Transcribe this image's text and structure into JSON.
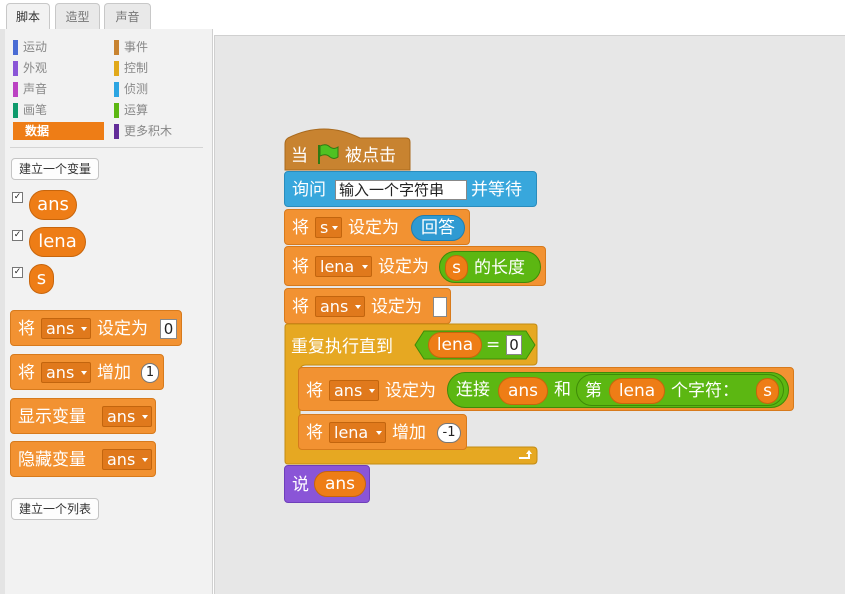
{
  "tabs": [
    "脚本",
    "造型",
    "声音"
  ],
  "categories": [
    {
      "label": "运动",
      "color": "#4a6cd4"
    },
    {
      "label": "外观",
      "color": "#8a55d7"
    },
    {
      "label": "声音",
      "color": "#bb42c3"
    },
    {
      "label": "画笔",
      "color": "#0e9a6c"
    },
    {
      "label": "数据",
      "color": "#ee7d16"
    },
    {
      "label": "事件",
      "color": "#c88330"
    },
    {
      "label": "控制",
      "color": "#e1a91a"
    },
    {
      "label": "侦测",
      "color": "#2ca5e2"
    },
    {
      "label": "运算",
      "color": "#5cb712"
    },
    {
      "label": "更多积木",
      "color": "#632d99"
    }
  ],
  "selected_category": "数据",
  "palette": {
    "make_variable": "建立一个变量",
    "make_list": "建立一个列表",
    "variables": [
      {
        "name": "ans",
        "checked": true
      },
      {
        "name": "lena",
        "checked": true
      },
      {
        "name": "s",
        "checked": true
      }
    ],
    "set_block": {
      "prefix": "将",
      "var": "ans",
      "suffix": "设定为",
      "value": "0"
    },
    "change_block": {
      "prefix": "将",
      "var": "ans",
      "suffix": "增加",
      "value": "1"
    },
    "show_block": {
      "prefix": "显示变量",
      "var": "ans"
    },
    "hide_block": {
      "prefix": "隐藏变量",
      "var": "ans"
    }
  },
  "script": {
    "hat": {
      "pre": "当",
      "post": "被点击"
    },
    "ask": {
      "pre": "询问",
      "prompt": "输入一个字符串",
      "post": "并等待"
    },
    "set_s": {
      "pre": "将",
      "var": "s",
      "mid": "设定为",
      "answer": "回答"
    },
    "set_lena": {
      "pre": "将",
      "var": "lena",
      "mid": "设定为",
      "arg": "s",
      "post": "的长度"
    },
    "set_ans": {
      "pre": "将",
      "var": "ans",
      "mid": "设定为",
      "value": ""
    },
    "repeat": {
      "pre": "重复执行直到",
      "left": "lena",
      "op": "=",
      "right": "0"
    },
    "inner_set": {
      "pre": "将",
      "var": "ans",
      "mid": "设定为",
      "join": "连接",
      "a": "ans",
      "and": "和",
      "di": "第",
      "idx": "lena",
      "char": "个字符：",
      "s": "s"
    },
    "inner_change": {
      "pre": "将",
      "var": "lena",
      "mid": "增加",
      "value": "-1"
    },
    "say": {
      "pre": "说",
      "arg": "ans"
    }
  }
}
